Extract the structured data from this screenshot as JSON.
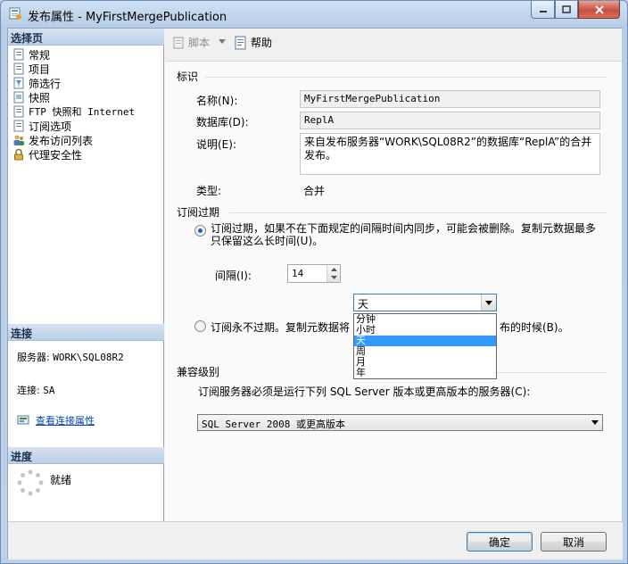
{
  "window": {
    "title": "发布属性 - MyFirstMergePublication"
  },
  "left": {
    "select_page_header": "选择页",
    "pages": [
      {
        "label": "常规",
        "icon": "page-icon"
      },
      {
        "label": "项目",
        "icon": "page-icon"
      },
      {
        "label": "筛选行",
        "icon": "page-icon"
      },
      {
        "label": "快照",
        "icon": "page-icon"
      },
      {
        "label": "FTP 快照和 Internet",
        "icon": "page-icon"
      },
      {
        "label": "订阅选项",
        "icon": "page-icon"
      },
      {
        "label": "发布访问列表",
        "icon": "users-icon"
      },
      {
        "label": "代理安全性",
        "icon": "lock-icon"
      }
    ],
    "connection_header": "连接",
    "server_label": "服务器:",
    "server_value": "WORK\\SQL08R2",
    "connection_label": "连接:",
    "connection_value": "SA",
    "view_connection_link": "查看连接属性",
    "progress_header": "进度",
    "progress_status": "就绪"
  },
  "toolbar": {
    "script_label": "脚本",
    "help_label": "帮助"
  },
  "identity": {
    "group_title": "标识",
    "name_label": "名称(N):",
    "name_value": "MyFirstMergePublication",
    "database_label": "数据库(D):",
    "database_value": "ReplA",
    "description_label": "说明(E):",
    "description_value": "来自发布服务器“WORK\\SQL08R2”的数据库“ReplA”的合并发布。",
    "type_label": "类型:",
    "type_value": "合并"
  },
  "expiration": {
    "group_title": "订阅过期",
    "option_expire_label": "订阅过期，如果不在下面规定的间隔时间内同步，可能会被删除。复制元数据最多只保留这么长时间(U)。",
    "interval_label": "间隔(I):",
    "interval_value": "14",
    "unit_selected": "天",
    "unit_options": [
      "分钟",
      "小时",
      "天",
      "周",
      "月",
      "年"
    ],
    "unit_selected_index": 2,
    "option_never_label": "订阅永不过期。复制元数据将",
    "option_never_label_tail": "布的时候(B)。"
  },
  "compatibility": {
    "group_title": "兼容级别",
    "description": "订阅服务器必须是运行下列 SQL Server 版本或更高版本的服务器(C):",
    "selected": "SQL Server 2008 或更高版本"
  },
  "buttons": {
    "ok": "确定",
    "cancel": "取消"
  }
}
